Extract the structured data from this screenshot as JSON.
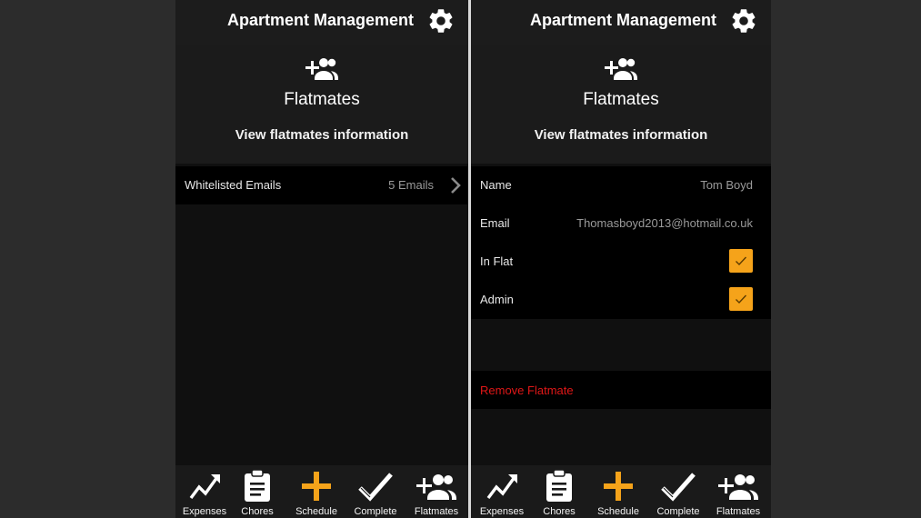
{
  "app": {
    "title": "Apartment Management"
  },
  "hero": {
    "title": "Flatmates",
    "subtitle": "View flatmates information",
    "icon": "add-person-icon"
  },
  "left": {
    "rows": [
      {
        "label": "Whitelisted Emails",
        "value": "5 Emails"
      }
    ]
  },
  "right": {
    "name": {
      "label": "Name",
      "value": "Tom Boyd"
    },
    "email": {
      "label": "Email",
      "value": "Thomasboyd2013@hotmail.co.uk"
    },
    "in_flat": {
      "label": "In Flat",
      "checked": true
    },
    "admin": {
      "label": "Admin",
      "checked": true
    },
    "remove_label": "Remove Flatmate"
  },
  "nav": [
    {
      "label": "Expenses",
      "icon": "trending-up-icon"
    },
    {
      "label": "Chores",
      "icon": "clipboard-icon"
    },
    {
      "label": "Schedule",
      "icon": "plus-icon"
    },
    {
      "label": "Complete",
      "icon": "checkmark-icon"
    },
    {
      "label": "Flatmates",
      "icon": "add-people-icon"
    }
  ],
  "colors": {
    "accent": "#f5a31a",
    "danger": "#e01717",
    "background": "#101010",
    "outer": "#2c2c2c"
  }
}
